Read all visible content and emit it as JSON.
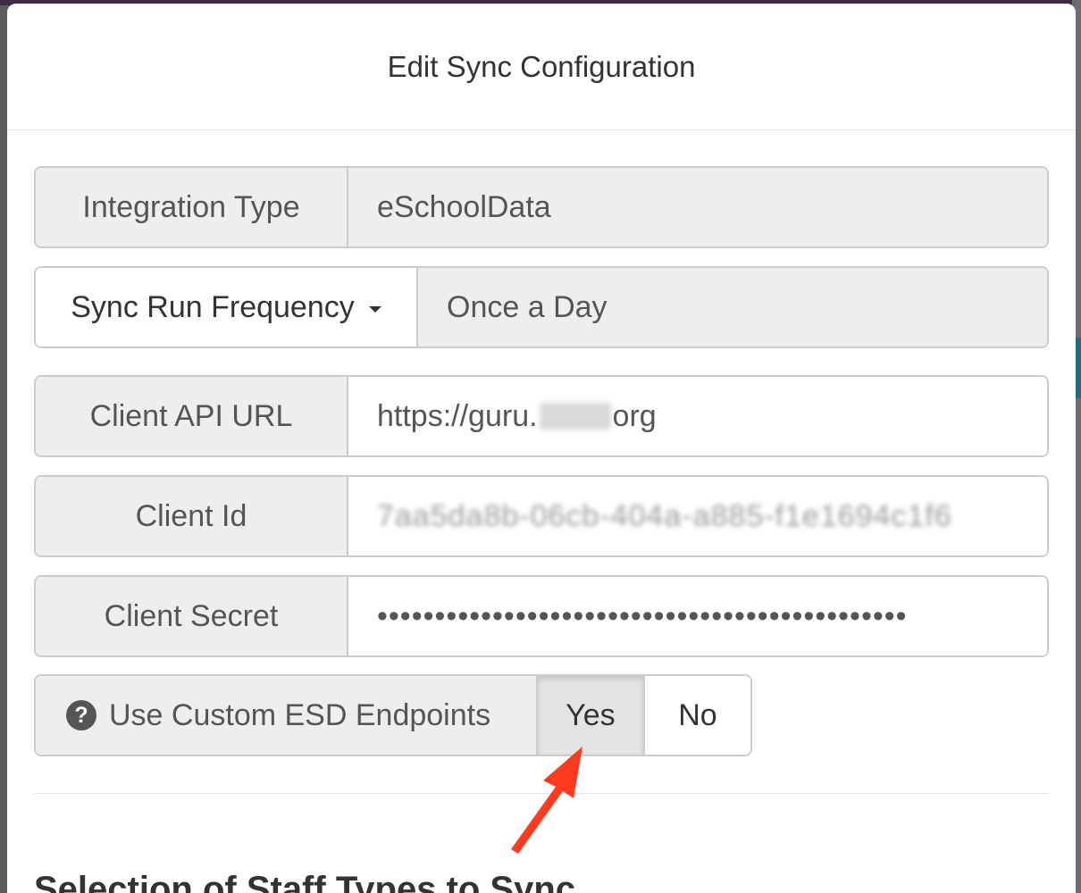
{
  "modal": {
    "title": "Edit Sync Configuration"
  },
  "fields": {
    "integration_type": {
      "label": "Integration Type",
      "value": "eSchoolData"
    },
    "sync_frequency": {
      "label": "Sync Run Frequency",
      "value": "Once a Day"
    },
    "client_api_url": {
      "label": "Client API URL",
      "value_prefix": "https://guru.",
      "value_suffix": "org"
    },
    "client_id": {
      "label": "Client Id",
      "value": "7aa5da8b-06cb-404a-a885-f1e1694c1f6"
    },
    "client_secret": {
      "label": "Client Secret",
      "value": "••••••••••••••••••••••••••••••••••••••••••••••"
    }
  },
  "custom_endpoints": {
    "label": "Use Custom ESD Endpoints",
    "yes": "Yes",
    "no": "No",
    "selected": "Yes"
  },
  "section": {
    "title": "Selection of Staff Types to Sync"
  },
  "colors": {
    "accent_arrow": "#ff3b1f",
    "addon_bg": "#eeeeee",
    "border": "#cccccc"
  },
  "icons": {
    "help": "question-circle-icon",
    "caret": "caret-down-icon"
  }
}
